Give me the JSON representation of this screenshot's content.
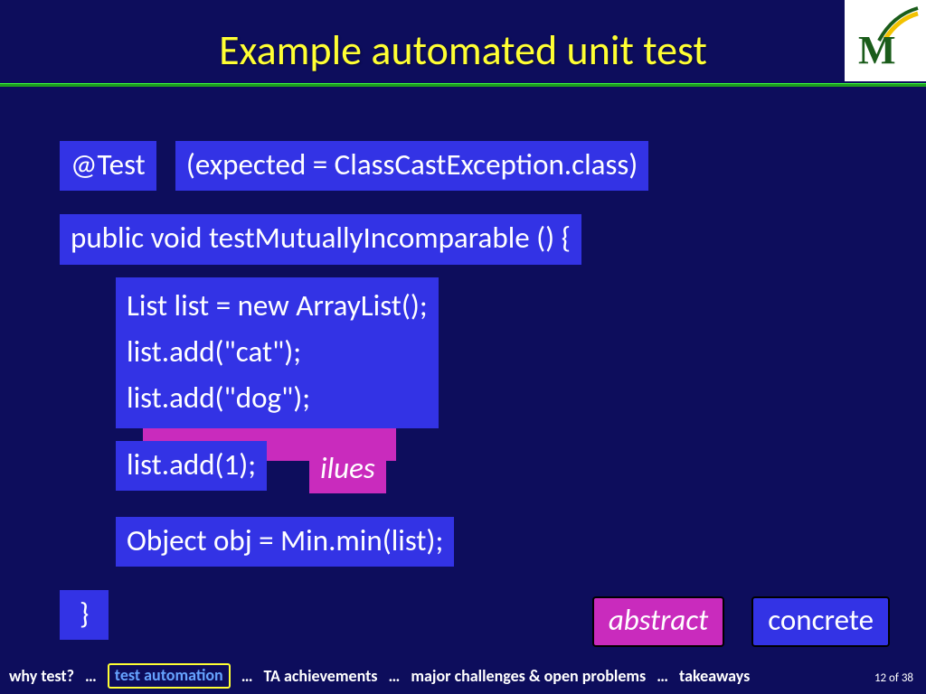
{
  "title": "Example automated unit test",
  "logo": {
    "letter": "M"
  },
  "code": {
    "annotation": "@Test",
    "expected": "(expected = ClassCastException.class)",
    "signature": "public void testMutuallyIncomparable () {",
    "block1": "List list = new ArrayList();\nlist.add(\"cat\");\nlist.add(\"dog\");",
    "pink_peek": "ilues",
    "block2": "list.add(1);",
    "block3": "Object obj = Min.min(list);",
    "close": "}"
  },
  "legend": {
    "abstract": "abstract",
    "concrete": "concrete"
  },
  "footer": {
    "c1": "why test?",
    "s": "…",
    "c2": "test automation",
    "c3": "TA achievements",
    "c4": "major challenges & open problems",
    "c5": "takeaways"
  },
  "page": "12 of 38"
}
